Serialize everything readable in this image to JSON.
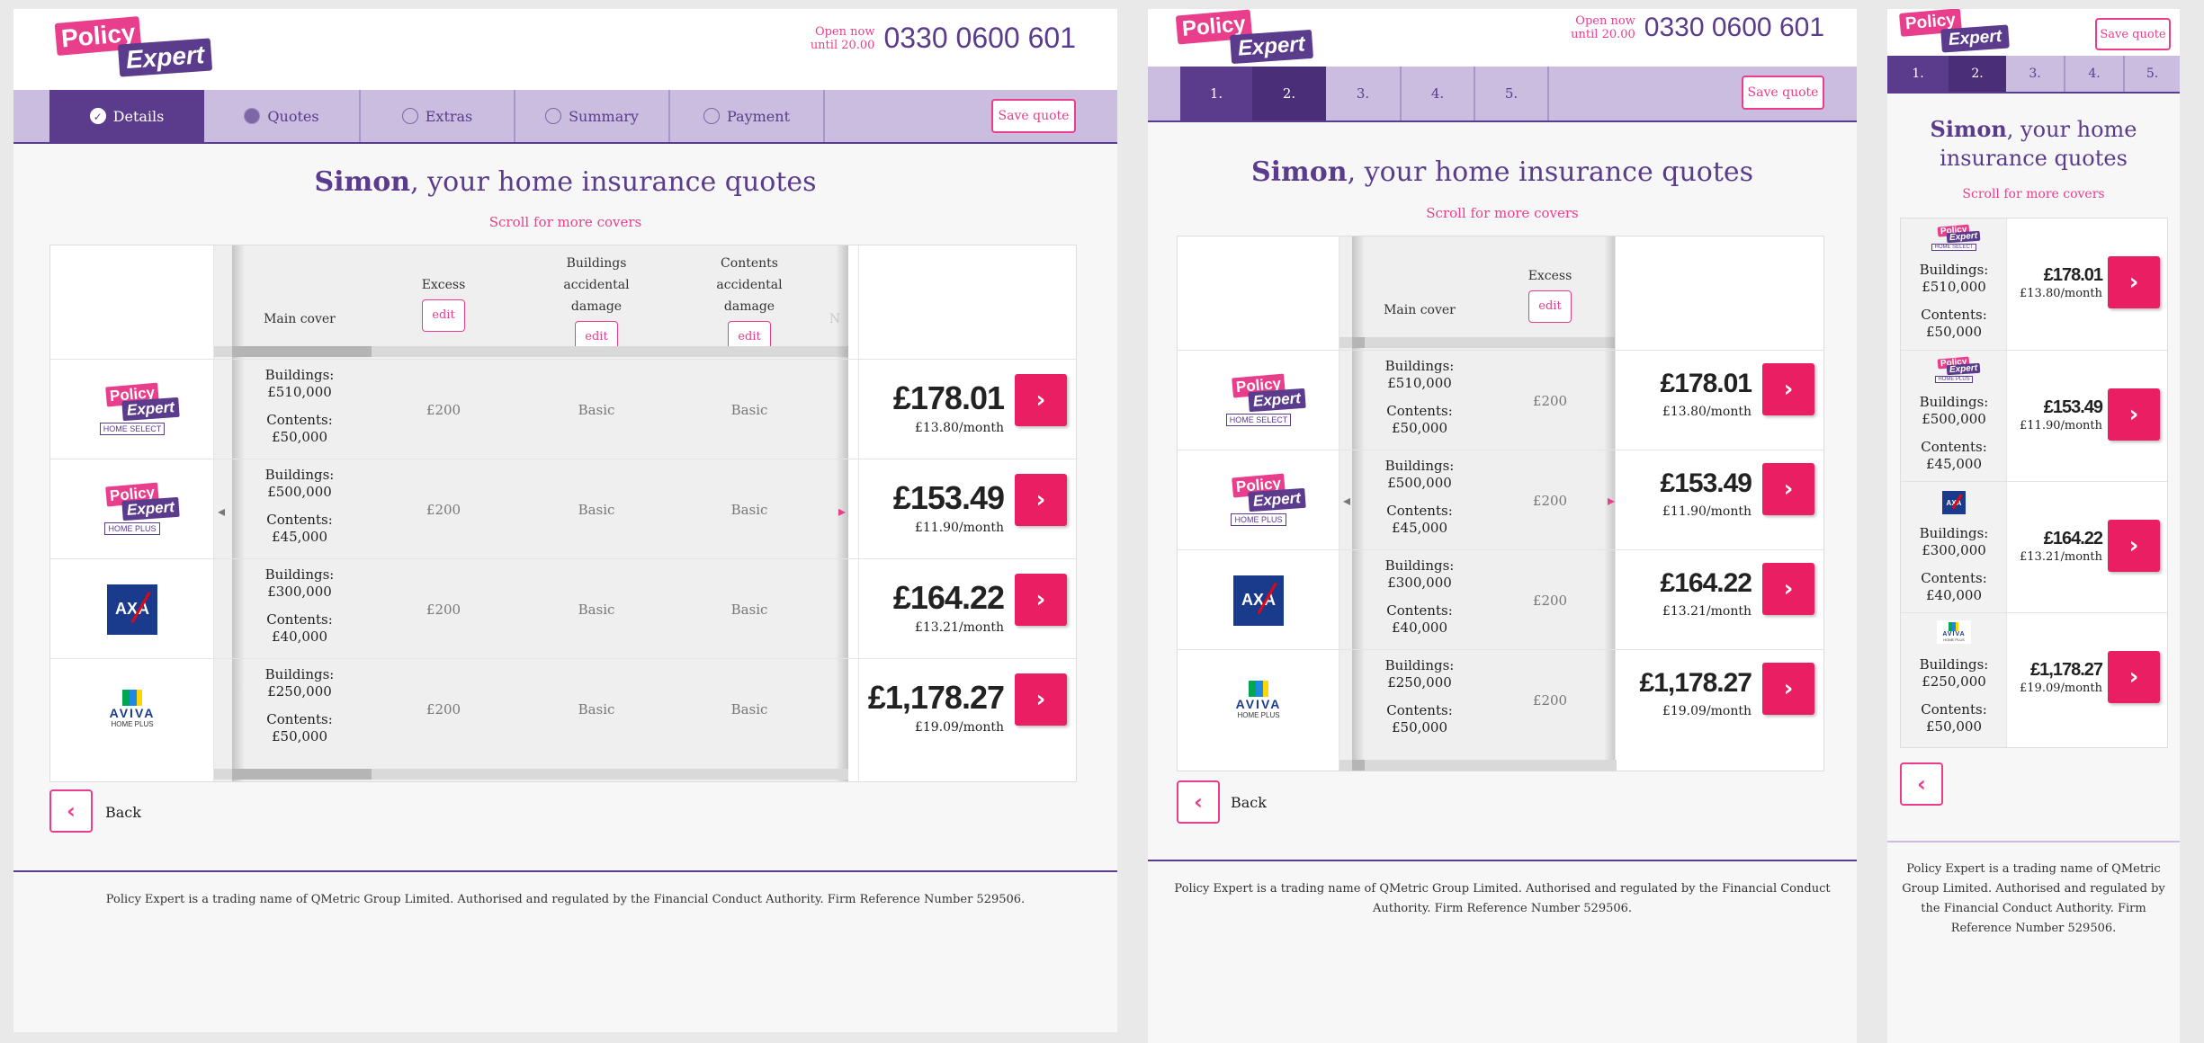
{
  "brand": {
    "line1": "Policy",
    "line2": "Expert",
    "pink": "#e83e8c",
    "purple": "#5b3b8c"
  },
  "header": {
    "open_line1": "Open now",
    "open_line2": "until 20.00",
    "phone": "0330 0600 601"
  },
  "nav": {
    "steps": [
      "Details",
      "Quotes",
      "Extras",
      "Summary",
      "Payment"
    ],
    "numbered": [
      "1.",
      "2.",
      "3.",
      "4.",
      "5."
    ],
    "active_index": 1,
    "save_label": "Save quote"
  },
  "title": {
    "name": "Simon",
    "rest": ", your home insurance quotes"
  },
  "scroll_hint": "Scroll for more covers",
  "columns": {
    "main_cover": "Main cover",
    "excess": "Excess",
    "buildings_ad": "Buildings accidental damage",
    "contents_ad": "Contents accidental damage",
    "edit": "edit",
    "next_peek": "N"
  },
  "quotes": [
    {
      "logo": "policy-expert-home-select",
      "logo_sub": "HOME SELECT",
      "buildings_label": "Buildings:",
      "buildings": "£510,000",
      "contents_label": "Contents:",
      "contents": "£50,000",
      "excess": "£200",
      "bad": "Basic",
      "cad": "Basic",
      "price": "£178.01",
      "monthly": "£13.80/month"
    },
    {
      "logo": "policy-expert-home-plus",
      "logo_sub": "HOME PLUS",
      "buildings_label": "Buildings:",
      "buildings": "£500,000",
      "contents_label": "Contents:",
      "contents": "£45,000",
      "excess": "£200",
      "bad": "Basic",
      "cad": "Basic",
      "price": "£153.49",
      "monthly": "£11.90/month"
    },
    {
      "logo": "axa",
      "logo_sub": "AXA",
      "buildings_label": "Buildings:",
      "buildings": "£300,000",
      "contents_label": "Contents:",
      "contents": "£40,000",
      "excess": "£200",
      "bad": "Basic",
      "cad": "Basic",
      "price": "£164.22",
      "monthly": "£13.21/month"
    },
    {
      "logo": "aviva-home-plus",
      "logo_sub": "AVIVA",
      "logo_sub2": "HOME PLUS",
      "buildings_label": "Buildings:",
      "buildings": "£250,000",
      "contents_label": "Contents:",
      "contents": "£50,000",
      "excess": "£200",
      "bad": "Basic",
      "cad": "Basic",
      "price": "£1,178.27",
      "monthly": "£19.09/month"
    }
  ],
  "icons": {
    "select": "chevron-right-icon",
    "back": "chevron-left-icon",
    "scroll_left": "caret-left-icon",
    "scroll_right": "caret-right-icon",
    "done": "check-circle-icon"
  },
  "back_label": "Back",
  "footer": {
    "text": "Policy Expert is a trading name of QMetric Group Limited. Authorised and regulated by the Financial Conduct Authority. Firm Reference Number 529506."
  }
}
